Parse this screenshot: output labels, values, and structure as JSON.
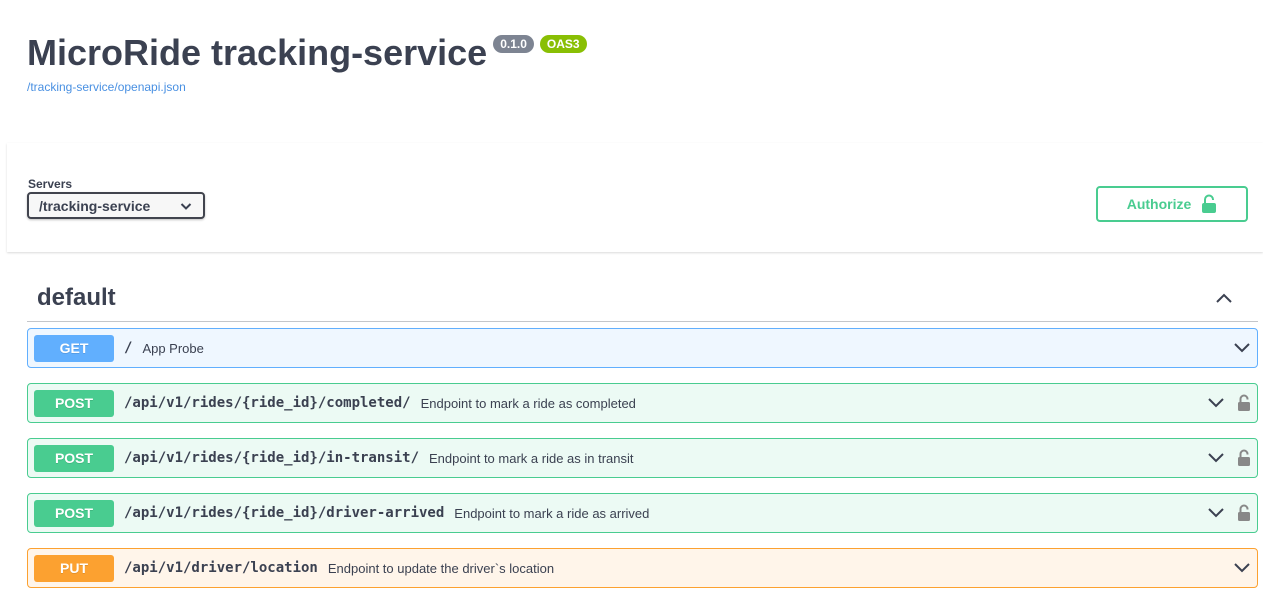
{
  "info": {
    "title": "MicroRide tracking-service",
    "version": "0.1.0",
    "oas": "OAS3",
    "spec_url": "/tracking-service/openapi.json"
  },
  "servers": {
    "label": "Servers",
    "selected": "/tracking-service"
  },
  "authorize": {
    "label": "Authorize",
    "icon": "unlocked-icon"
  },
  "tag": {
    "name": "default",
    "toggle_icon": "chevron-up-icon"
  },
  "operations": [
    {
      "method": "GET",
      "path": "/",
      "summary": "App Probe",
      "locked": false
    },
    {
      "method": "POST",
      "path": "/api/v1/rides/{ride_id}/completed/",
      "summary": "Endpoint to mark a ride as completed",
      "locked": true
    },
    {
      "method": "POST",
      "path": "/api/v1/rides/{ride_id}/in-transit/",
      "summary": "Endpoint to mark a ride as in transit",
      "locked": true
    },
    {
      "method": "POST",
      "path": "/api/v1/rides/{ride_id}/driver-arrived",
      "summary": "Endpoint to mark a ride as arrived",
      "locked": true
    },
    {
      "method": "PUT",
      "path": "/api/v1/driver/location",
      "summary": "Endpoint to update the driver`s location",
      "locked": false
    }
  ],
  "colors": {
    "get": "#61affe",
    "post": "#49cc90",
    "put": "#fca130",
    "version_badge": "#7d8492",
    "oas_badge": "#89bf04",
    "link": "#4990e2"
  }
}
